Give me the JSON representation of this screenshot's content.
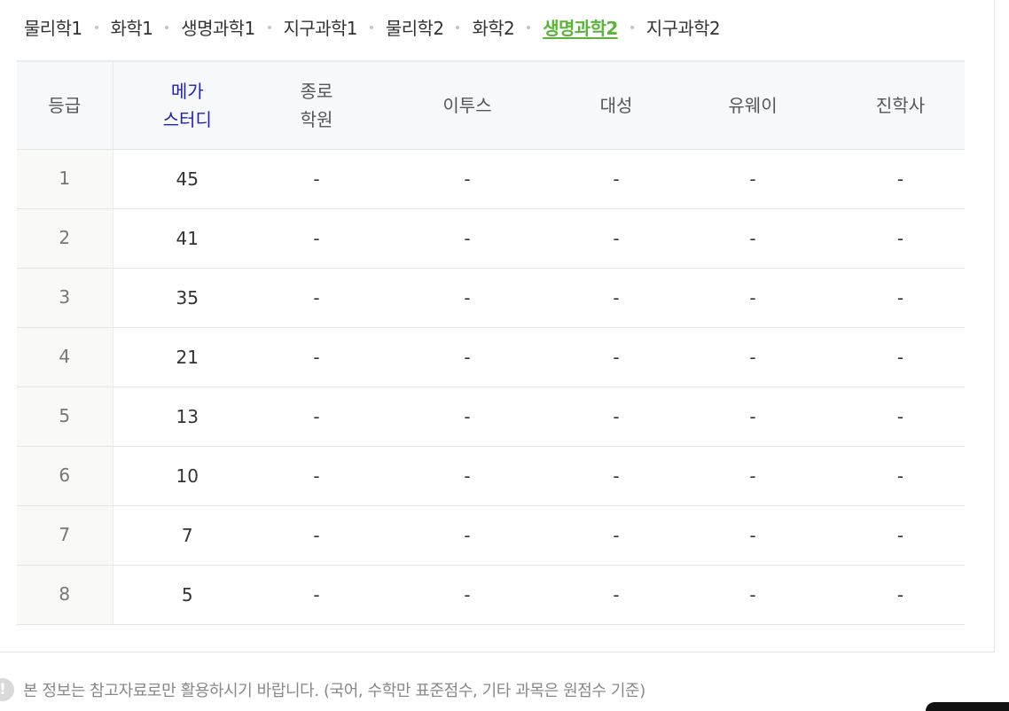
{
  "tabs": [
    {
      "label": "물리학1",
      "active": false
    },
    {
      "label": "화학1",
      "active": false
    },
    {
      "label": "생명과학1",
      "active": false
    },
    {
      "label": "지구과학1",
      "active": false
    },
    {
      "label": "물리학2",
      "active": false
    },
    {
      "label": "화학2",
      "active": false
    },
    {
      "label": "생명과학2",
      "active": true
    },
    {
      "label": "지구과학2",
      "active": false
    }
  ],
  "table": {
    "headers": {
      "grade": "등급",
      "megastudy_line1": "메가",
      "megastudy_line2": "스터디",
      "jongro_line1": "종로",
      "jongro_line2": "학원",
      "etoos": "이투스",
      "daesung": "대성",
      "uway": "유웨이",
      "jinhaksa": "진학사"
    },
    "rows": [
      {
        "grade": "1",
        "megastudy": "45",
        "jongro": "-",
        "etoos": "-",
        "daesung": "-",
        "uway": "-",
        "jinhaksa": "-"
      },
      {
        "grade": "2",
        "megastudy": "41",
        "jongro": "-",
        "etoos": "-",
        "daesung": "-",
        "uway": "-",
        "jinhaksa": "-"
      },
      {
        "grade": "3",
        "megastudy": "35",
        "jongro": "-",
        "etoos": "-",
        "daesung": "-",
        "uway": "-",
        "jinhaksa": "-"
      },
      {
        "grade": "4",
        "megastudy": "21",
        "jongro": "-",
        "etoos": "-",
        "daesung": "-",
        "uway": "-",
        "jinhaksa": "-"
      },
      {
        "grade": "5",
        "megastudy": "13",
        "jongro": "-",
        "etoos": "-",
        "daesung": "-",
        "uway": "-",
        "jinhaksa": "-"
      },
      {
        "grade": "6",
        "megastudy": "10",
        "jongro": "-",
        "etoos": "-",
        "daesung": "-",
        "uway": "-",
        "jinhaksa": "-"
      },
      {
        "grade": "7",
        "megastudy": "7",
        "jongro": "-",
        "etoos": "-",
        "daesung": "-",
        "uway": "-",
        "jinhaksa": "-"
      },
      {
        "grade": "8",
        "megastudy": "5",
        "jongro": "-",
        "etoos": "-",
        "daesung": "-",
        "uway": "-",
        "jinhaksa": "-"
      }
    ]
  },
  "notice": {
    "icon": "exclamation-icon",
    "icon_glyph": "!",
    "text": "본 정보는 참고자료로만 활용하시기 바랍니다. (국어, 수학만 표준점수, 기타 과목은 원점수 기준)"
  },
  "colors": {
    "active_tab": "#5bb43a",
    "megastudy_header": "#1f1fb8",
    "header_bg": "#f7f8fa"
  }
}
